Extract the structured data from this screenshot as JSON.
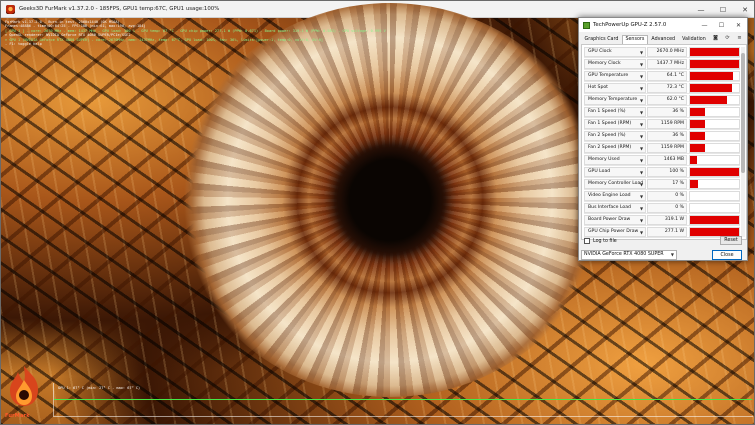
{
  "furmark": {
    "title": "Geeks3D FurMark v1.37.2.0 - 185FPS, GPU1 temp:67C, GPU1 usage:100%",
    "controls": {
      "minimize": "—",
      "maximize": "☐",
      "close": "✕"
    },
    "osd": [
      "FurMark v1.37.2.0 - Burn-in test, 2560x1440 (0X MSAA)",
      "Frames:48886 - time:00:04:25 - FPS:186 (min:61, max:190, avg:184)",
      "[ GPU 1 ] - core: 2670 MHz - mem: 1437 MHz - GPU load: 100 % - GPU temp: 67 °C - GPU chip power: 277.1 W (PPW: 0.671) - Board power: 319.1 W (PPW: 0.583) - GPU voltage: 0.995 V",
      "> OpenGL renderer: NVIDIA GeForce RTX 4080 SUPER/PCIe/SSE2",
      "> GPU 1 (NVIDIA GeForce RTX 4080 SUPER) - core: 2670MHz, mem: 1437MHz, temp: 67°C, GPU load: 100%, fan: 36%, limits:[power:1, temp:0, volt:0, OV:0]",
      "- F1: toggle help"
    ],
    "graph_label": "GPU 1: 67° C (min: 27° C - max: 67° C)",
    "logo_text": "FurMark"
  },
  "gpuz": {
    "title": "TechPowerUp GPU-Z 2.57.0",
    "controls": {
      "minimize": "—",
      "maximize": "☐",
      "close": "✕"
    },
    "tabs": [
      "Graphics Card",
      "Sensors",
      "Advanced",
      "Validation"
    ],
    "active_tab": "Sensors",
    "tool_icons": [
      "camera-icon",
      "refresh-icon",
      "menu-icon"
    ],
    "sensors": [
      {
        "name": "GPU Clock",
        "value": "2670.0 MHz",
        "level": 1.0
      },
      {
        "name": "Memory Clock",
        "value": "1437.7 MHz",
        "level": 1.0
      },
      {
        "name": "GPU Temperature",
        "value": "64.1 °C",
        "level": 0.88
      },
      {
        "name": "Hot Spot",
        "value": "72.3 °C",
        "level": 0.85
      },
      {
        "name": "Memory Temperature",
        "value": "62.0 °C",
        "level": 0.75
      },
      {
        "name": "Fan 1 Speed (%)",
        "value": "36 %",
        "level": 0.3
      },
      {
        "name": "Fan 1 Speed (RPM)",
        "value": "1159 RPM",
        "level": 0.3
      },
      {
        "name": "Fan 2 Speed (%)",
        "value": "36 %",
        "level": 0.3
      },
      {
        "name": "Fan 2 Speed (RPM)",
        "value": "1159 RPM",
        "level": 0.3
      },
      {
        "name": "Memory Used",
        "value": "1463 MB",
        "level": 0.15
      },
      {
        "name": "GPU Load",
        "value": "100 %",
        "level": 1.0
      },
      {
        "name": "Memory Controller Load",
        "value": "17 %",
        "level": 0.17
      },
      {
        "name": "Video Engine Load",
        "value": "0 %",
        "level": 0.0
      },
      {
        "name": "Bus Interface Load",
        "value": "0 %",
        "level": 0.0
      },
      {
        "name": "Board Power Draw",
        "value": "319.1 W",
        "level": 1.0
      },
      {
        "name": "GPU Chip Power Draw",
        "value": "277.1 W",
        "level": 1.0
      }
    ],
    "log_label": "Log to file",
    "reset_label": "Reset",
    "gpu_selected": "NVIDIA GeForce RTX 4080 SUPER",
    "close_label": "Close",
    "colors": {
      "graph_fill": "#e00000",
      "accent": "#0067c0"
    }
  }
}
